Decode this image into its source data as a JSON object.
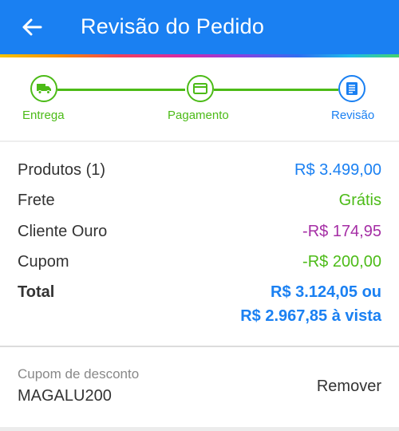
{
  "header": {
    "title": "Revisão do Pedido",
    "back_icon": "arrow-left-icon",
    "background_color": "#1a80f2"
  },
  "stepper": {
    "steps": [
      {
        "label": "Entrega",
        "icon": "truck-icon",
        "status": "done"
      },
      {
        "label": "Pagamento",
        "icon": "credit-card-icon",
        "status": "done"
      },
      {
        "label": "Revisão",
        "icon": "document-icon",
        "status": "active"
      }
    ],
    "done_color": "#4cbb17",
    "active_color": "#1a80f2"
  },
  "summary": {
    "rows": [
      {
        "label": "Produtos (1)",
        "value": "R$ 3.499,00",
        "color": "#1a80f2"
      },
      {
        "label": "Frete",
        "value": "Grátis",
        "color": "#4cbb17"
      },
      {
        "label": "Cliente Ouro",
        "value": "-R$ 174,95",
        "color": "#a52ea5"
      },
      {
        "label": "Cupom",
        "value": "-R$ 200,00",
        "color": "#4cbb17"
      }
    ],
    "total": {
      "label": "Total",
      "value_installments": "R$ 3.124,05 ou",
      "value_cash": "R$ 2.967,85 à vista"
    }
  },
  "coupon": {
    "label": "Cupom de desconto",
    "code": "MAGALU200",
    "remove_label": "Remover"
  }
}
